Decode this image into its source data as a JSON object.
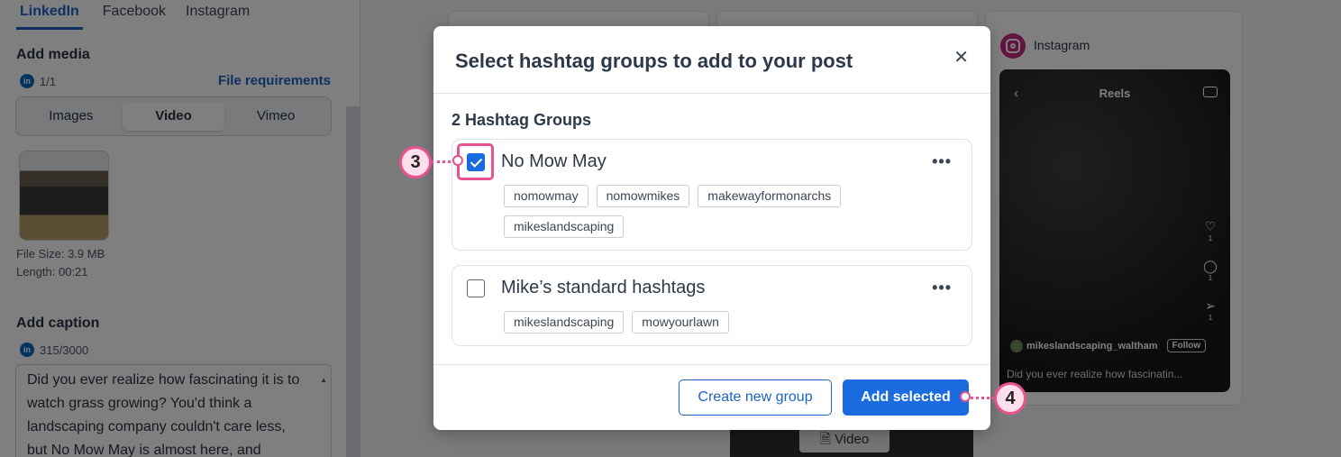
{
  "left": {
    "tabs": [
      "LinkedIn",
      "Facebook",
      "Instagram"
    ],
    "add_media_title": "Add media",
    "linkedin_badge": "in",
    "media_count": "1/1",
    "file_requirements": "File requirements",
    "media_tabs": [
      "Images",
      "Video",
      "Vimeo"
    ],
    "file_size": "File Size: 3.9 MB",
    "length": "Length: 00:21",
    "add_caption_title": "Add caption",
    "caption_count": "315/3000",
    "caption_text": "Did you ever realize how fascinating it is to watch grass growing? You'd think a landscaping company couldn't care less, but No Mow May is almost here, and"
  },
  "instagram_preview": {
    "title": "Instagram",
    "reel_title": "Reels",
    "likes": "1",
    "comments": "1",
    "shares": "1",
    "username": "mikeslandscaping_waltham",
    "follow_label": "Follow",
    "caption_preview": "Did you ever realize how fascinatin...",
    "video_chip": "Video"
  },
  "modal": {
    "title": "Select hashtag groups to add to your post",
    "groups_count": "2 Hashtag Groups",
    "groups": [
      {
        "name": "No Mow May",
        "checked": true,
        "tags": [
          "nomowmay",
          "nomowmikes",
          "makewayformonarchs",
          "mikeslandscaping"
        ]
      },
      {
        "name": "Mike’s standard hashtags",
        "checked": false,
        "tags": [
          "mikeslandscaping",
          "mowyourlawn"
        ]
      }
    ],
    "create_button": "Create new group",
    "add_button": "Add selected"
  },
  "callouts": [
    "3",
    "4"
  ],
  "colors": {
    "accent": "#1a6ae0",
    "callout": "#e8528f",
    "instagram": "#c1287e"
  }
}
